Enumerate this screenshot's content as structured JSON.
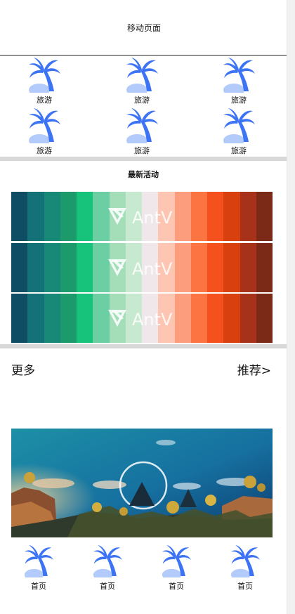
{
  "header": {
    "title": "移动页面"
  },
  "grid": {
    "items": [
      {
        "label": "旅游",
        "icon": "palm-tree-icon"
      },
      {
        "label": "旅游",
        "icon": "palm-tree-icon"
      },
      {
        "label": "旅游",
        "icon": "palm-tree-icon"
      },
      {
        "label": "旅游",
        "icon": "palm-tree-icon"
      },
      {
        "label": "旅游",
        "icon": "palm-tree-icon"
      },
      {
        "label": "旅游",
        "icon": "palm-tree-icon"
      }
    ]
  },
  "activities": {
    "title": "最新活动",
    "banner_logo": "AntV",
    "palette": [
      "#0e4d64",
      "#137177",
      "#188977",
      "#1d9a6c",
      "#17c37b",
      "#6ccea3",
      "#a3deb9",
      "#c7e9cf",
      "#efe7e9",
      "#fdc5b2",
      "#fc9e7d",
      "#fd7443",
      "#f4511e",
      "#d8410f",
      "#a7321a",
      "#7b2a17"
    ]
  },
  "more": {
    "label": "更多",
    "link": "推荐>"
  },
  "bottom_nav": {
    "items": [
      {
        "label": "首页",
        "icon": "palm-tree-icon"
      },
      {
        "label": "首页",
        "icon": "palm-tree-icon"
      },
      {
        "label": "首页",
        "icon": "palm-tree-icon"
      },
      {
        "label": "首页",
        "icon": "palm-tree-icon"
      }
    ]
  },
  "colors": {
    "icon_primary": "#3d73f5",
    "icon_secondary": "#b3cbfa",
    "separator": "#d7d7d7"
  }
}
